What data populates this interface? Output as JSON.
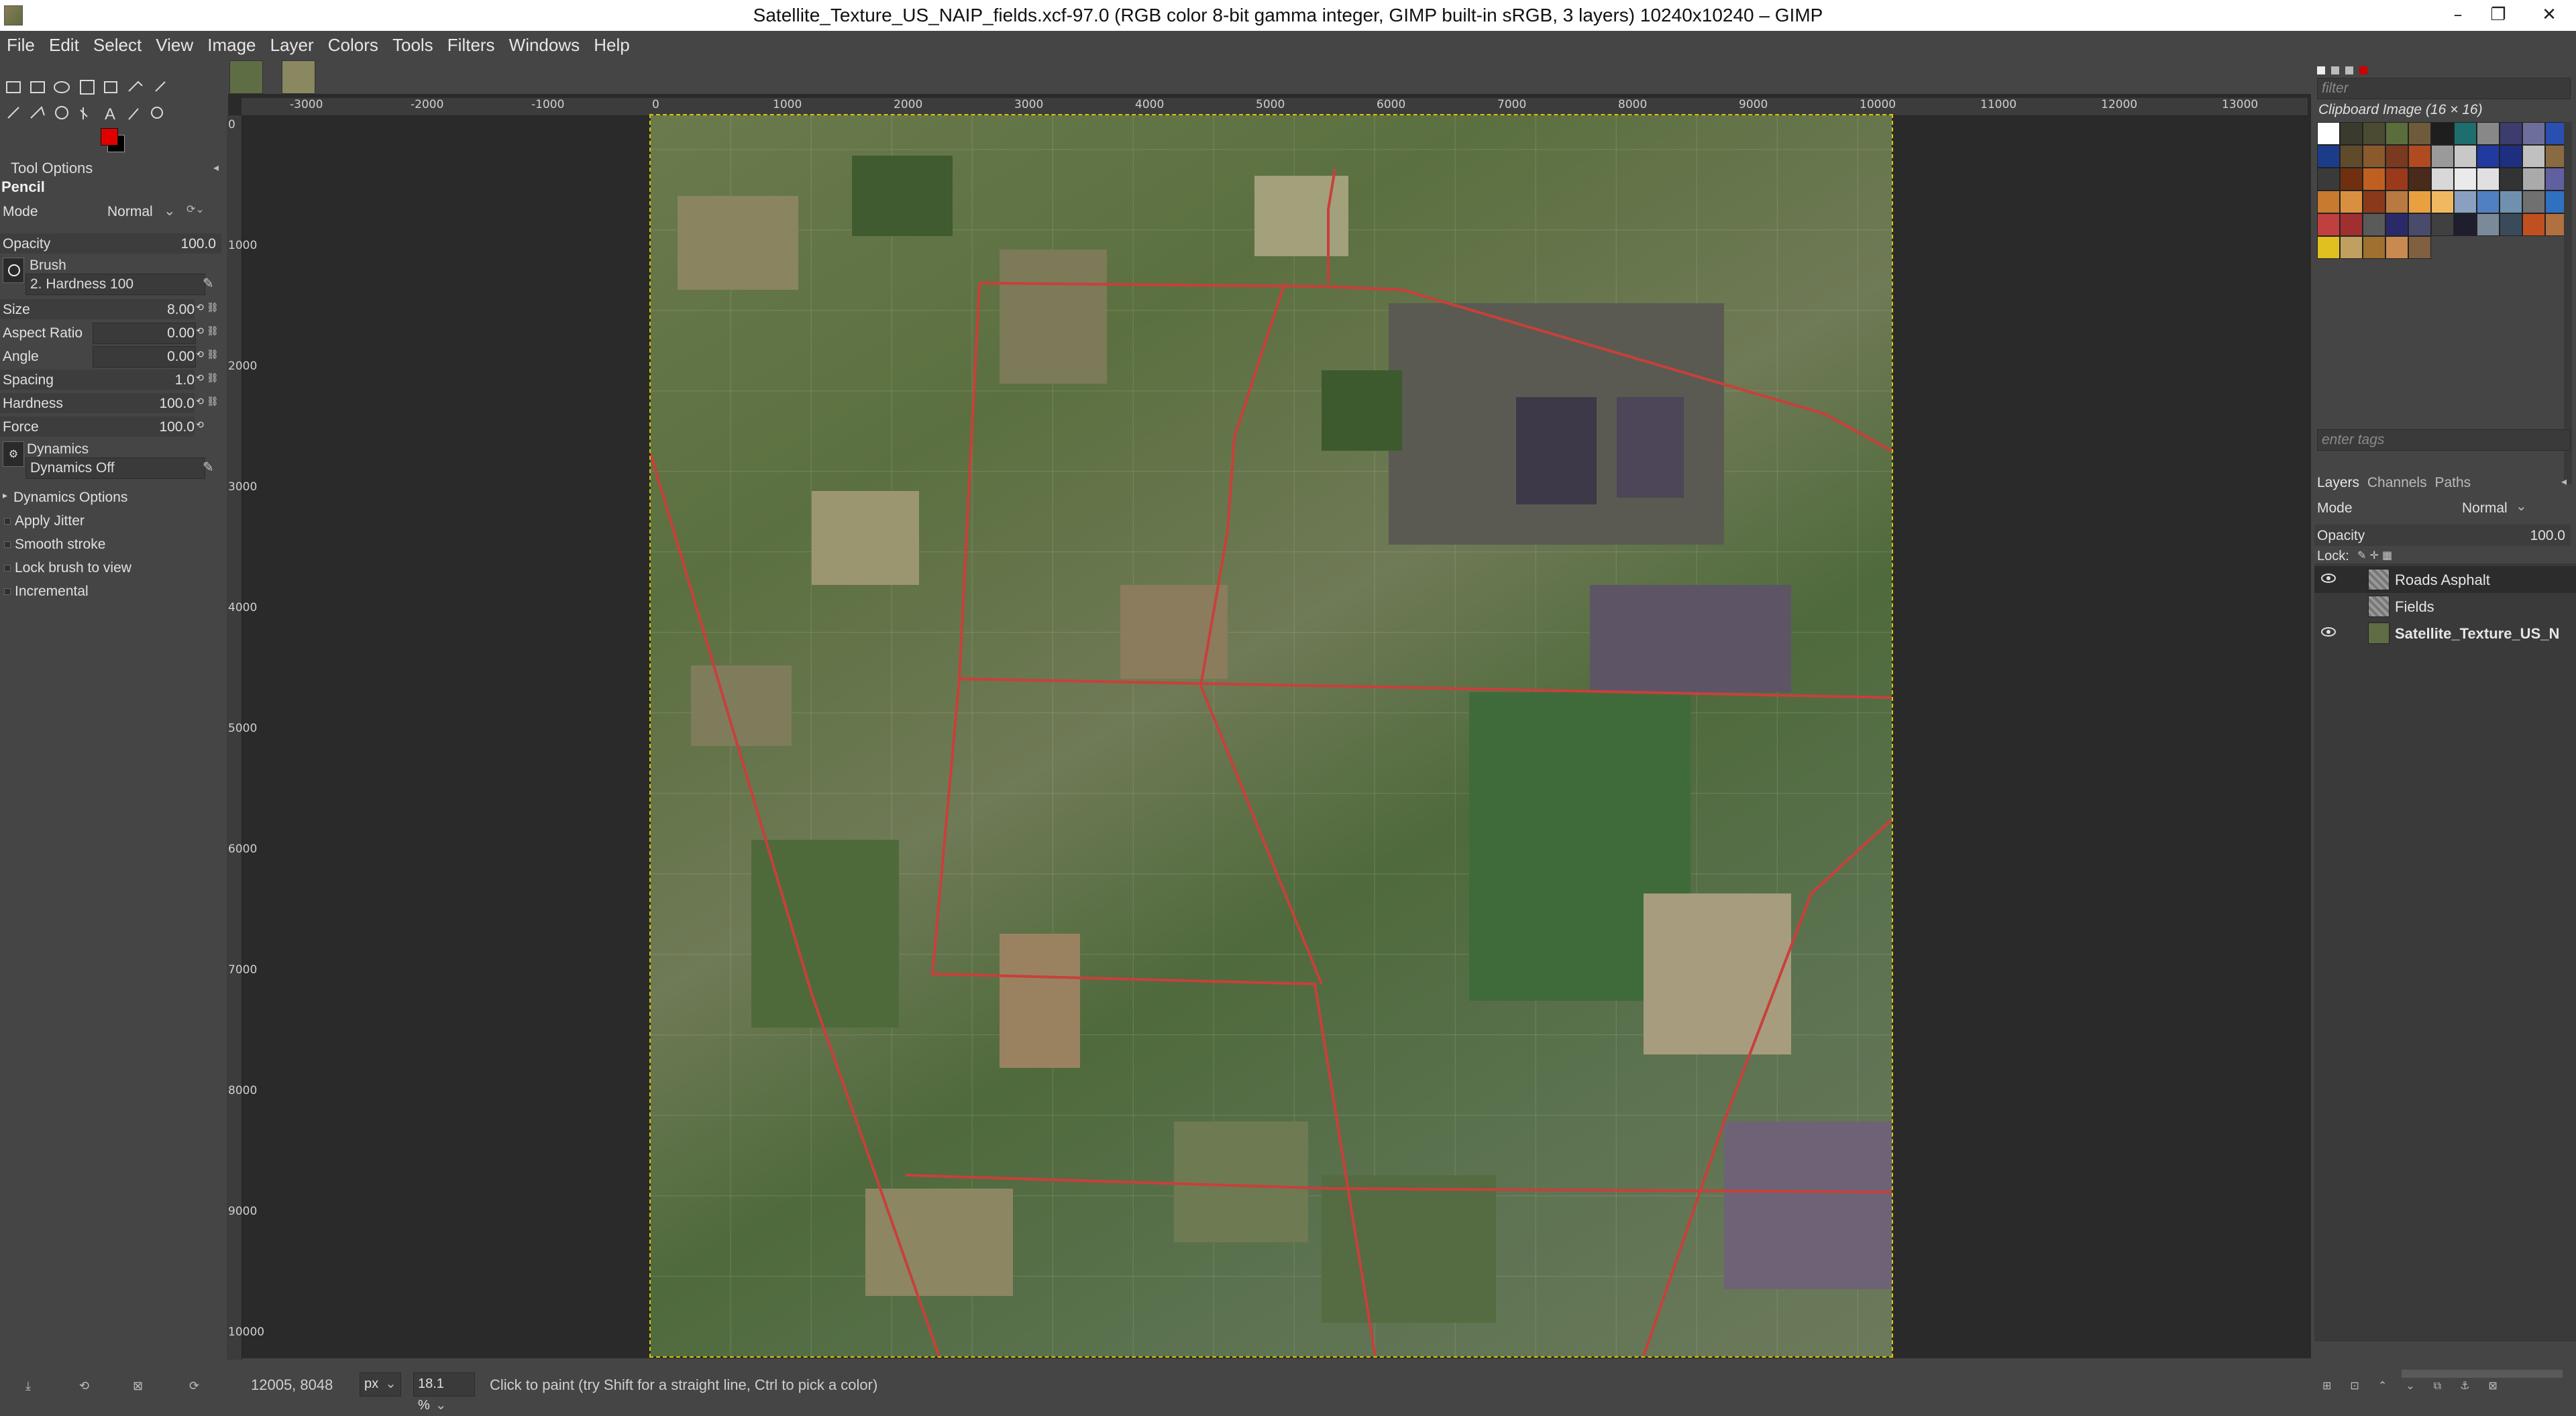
{
  "window": {
    "title": "Satellite_Texture_US_NAIP_fields.xcf-97.0 (RGB color 8-bit gamma integer, GIMP built-in sRGB, 3 layers) 10240x10240 – GIMP",
    "minimize_icon": "minimize-icon",
    "maximize_icon": "restore-icon",
    "close_icon": "close-icon"
  },
  "menubar": [
    "File",
    "Edit",
    "Select",
    "View",
    "Image",
    "Layer",
    "Colors",
    "Tools",
    "Filters",
    "Windows",
    "Help"
  ],
  "colors": {
    "foreground": "#e00000",
    "background": "#000000",
    "road_line": "#c8403a"
  },
  "tool_options": {
    "panel_title": "Tool Options",
    "tool_name": "Pencil",
    "mode_label": "Mode",
    "mode_value": "Normal",
    "opacity_label": "Opacity",
    "opacity_value": "100.0",
    "brush_label": "Brush",
    "brush_value": "2. Hardness 100",
    "size_label": "Size",
    "size_value": "8.00",
    "aspect_label": "Aspect Ratio",
    "aspect_value": "0.00",
    "angle_label": "Angle",
    "angle_value": "0.00",
    "spacing_label": "Spacing",
    "spacing_value": "1.0",
    "hardness_label": "Hardness",
    "hardness_value": "100.0",
    "force_label": "Force",
    "force_value": "100.0",
    "dynamics_label": "Dynamics",
    "dynamics_value": "Dynamics Off",
    "dynamics_options": "Dynamics Options",
    "apply_jitter": "Apply Jitter",
    "smooth_stroke": "Smooth stroke",
    "lock_brush": "Lock brush to view",
    "incremental": "Incremental"
  },
  "ruler": {
    "h_labels": [
      "-3000",
      "-2000",
      "-1000",
      "0",
      "1000",
      "2000",
      "3000",
      "4000",
      "5000",
      "6000",
      "7000",
      "8000",
      "9000",
      "10000",
      "11000",
      "12000",
      "13000"
    ],
    "v_labels": [
      "0",
      "1000",
      "2000",
      "3000",
      "4000",
      "5000",
      "6000",
      "7000",
      "8000",
      "9000",
      "10000"
    ]
  },
  "statusbar": {
    "coords": "12005, 8048",
    "unit": "px",
    "zoom": "18.1 %",
    "message": "Click to paint (try Shift for a straight line, Ctrl to pick a color)"
  },
  "patterns": {
    "filter_placeholder": "filter",
    "title": "Clipboard Image (16 × 16)",
    "tags_placeholder": "enter tags",
    "swatches": [
      "#ffffff",
      "#3a3a2e",
      "#4b4b33",
      "#5a6e3c",
      "#6f5b3c",
      "#1e1e1e",
      "#1f6e6e",
      "#888888",
      "#3c3c6e",
      "#6e6e9a",
      "#2b4fb0",
      "#1c3c8a",
      "#5f4a2c",
      "#8a5a2c",
      "#7a3a20",
      "#b04a20",
      "#9a9a9a",
      "#c8c8c8",
      "#203aa0",
      "#1e2e80",
      "#c0c0c0",
      "#8a6a40",
      "#3a3a3a",
      "#703010",
      "#c06020",
      "#9a3a1a",
      "#4a2a1a",
      "#d8d8d8",
      "#eaeaea",
      "#e0e0e0",
      "#333333",
      "#aaaaaa",
      "#6060a0",
      "#c87a30",
      "#d89040",
      "#8a3a1a",
      "#b87a40",
      "#e8a040",
      "#f0b860",
      "#8aa0c0",
      "#5080c0",
      "#7090b0",
      "#707070",
      "#3070c0",
      "#c04040",
      "#a03030",
      "#5a5a5a",
      "#2a2a6a",
      "#4a4a6a",
      "#404040",
      "#1e1e2e",
      "#7a8a9a",
      "#3a4a5a",
      "#c05020",
      "#b07040",
      "#e0c020",
      "#c0a060",
      "#a07030",
      "#c88a50",
      "#806040"
    ]
  },
  "layers": {
    "tab_layers": "Layers",
    "tab_channels": "Channels",
    "tab_paths": "Paths",
    "mode_label": "Mode",
    "mode_value": "Normal",
    "opacity_label": "Opacity",
    "opacity_value": "100.0",
    "lock_label": "Lock:",
    "items": [
      {
        "name": "Roads Asphalt",
        "visible": true
      },
      {
        "name": "Fields",
        "visible": false
      },
      {
        "name": "Satellite_Texture_US_N",
        "visible": true
      }
    ]
  }
}
